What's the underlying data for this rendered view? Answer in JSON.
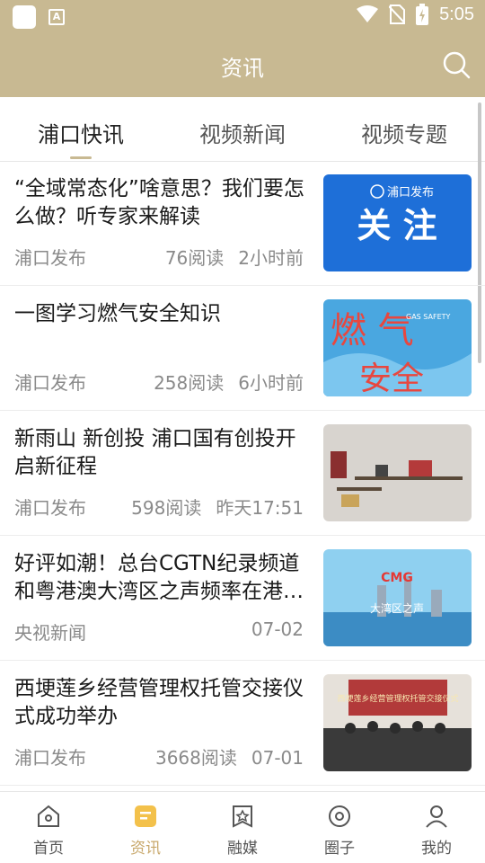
{
  "status_bar": {
    "time": "5:05"
  },
  "header": {
    "title": "资讯"
  },
  "tabs": [
    {
      "label": "浦口快讯"
    },
    {
      "label": "视频新闻"
    },
    {
      "label": "视频专题"
    }
  ],
  "thumb_texts": {
    "t1_brand": "浦口发布",
    "t1_main": "关 注",
    "t2_main": "燃 气",
    "t2_sub": "安全",
    "t2_small": "GAS SAFETY",
    "t4_logo": "CMG",
    "t4_sub": "大湾区之声",
    "t5_banner": "西埂莲乡经营管理权托管交接仪式"
  },
  "news": [
    {
      "title": "“全域常态化”啥意思？我们要怎么做？听专家来解读",
      "source": "浦口发布",
      "reads": "76阅读",
      "time": "2小时前"
    },
    {
      "title": "一图学习燃气安全知识",
      "source": "浦口发布",
      "reads": "258阅读",
      "time": "6小时前"
    },
    {
      "title": "新雨山 新创投 浦口国有创投开启新征程",
      "source": "浦口发布",
      "reads": "598阅读",
      "time": "昨天17:51"
    },
    {
      "title": "好评如潮！总台CGTN纪录频道和粤港澳大湾区之声频率在港…",
      "source": "央视新闻",
      "reads": "",
      "time": "07-02"
    },
    {
      "title": "西埂莲乡经营管理权托管交接仪式成功举办",
      "source": "浦口发布",
      "reads": "3668阅读",
      "time": "07-01"
    }
  ],
  "bottom_nav": [
    {
      "label": "首页"
    },
    {
      "label": "资讯"
    },
    {
      "label": "融媒"
    },
    {
      "label": "圈子"
    },
    {
      "label": "我的"
    }
  ],
  "colors": {
    "accent": "#c8b992",
    "nav_active": "#c8a86b"
  }
}
